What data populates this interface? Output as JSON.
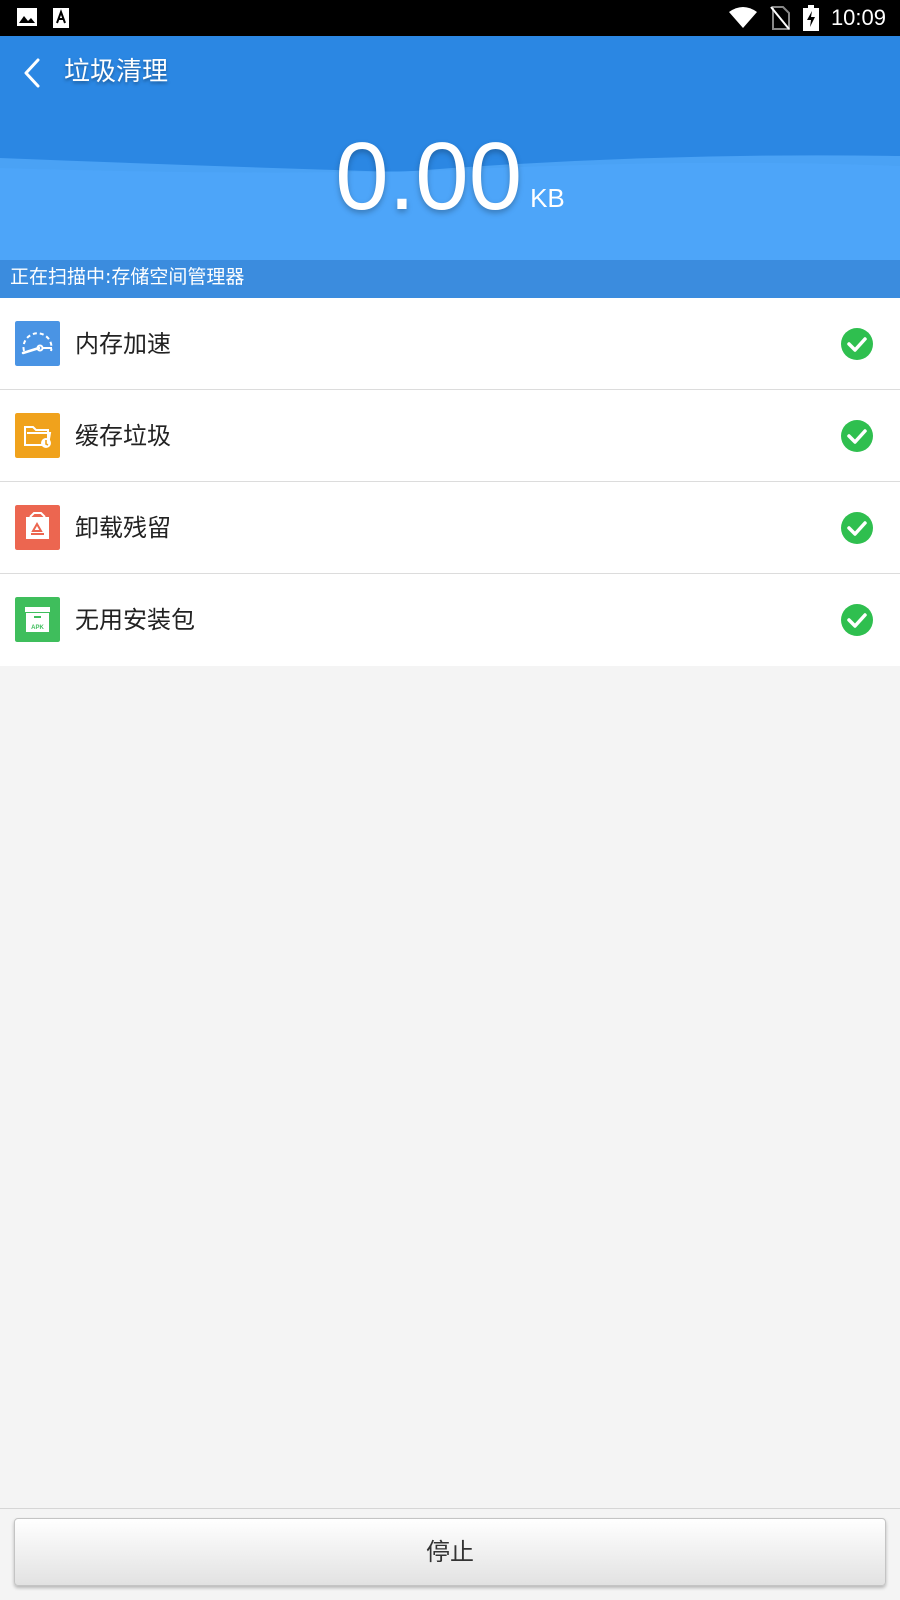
{
  "status_bar": {
    "time": "10:09",
    "left_icons": [
      "image-icon",
      "font-icon"
    ],
    "right_icons": [
      "wifi-icon",
      "no-sim-icon",
      "battery-charging-icon"
    ]
  },
  "header": {
    "title": "垃圾清理",
    "size_value": "0.00",
    "size_unit": "KB",
    "scan_status": "正在扫描中:存储空间管理器",
    "background_color": "#2f8ee8"
  },
  "items": [
    {
      "label": "内存加速",
      "icon": "speedometer-icon",
      "icon_color": "#4a94e4",
      "status": "check-icon"
    },
    {
      "label": "缓存垃圾",
      "icon": "cache-folder-icon",
      "icon_color": "#f0a21c",
      "status": "check-icon"
    },
    {
      "label": "卸载残留",
      "icon": "recycle-box-icon",
      "icon_color": "#ec6650",
      "status": "check-icon"
    },
    {
      "label": "无用安装包",
      "icon": "apk-box-icon",
      "icon_color": "#3fbe5c",
      "status": "check-icon"
    }
  ],
  "check_color": "#2fbf4f",
  "footer": {
    "stop_label": "停止",
    "apk_text": "APK"
  }
}
